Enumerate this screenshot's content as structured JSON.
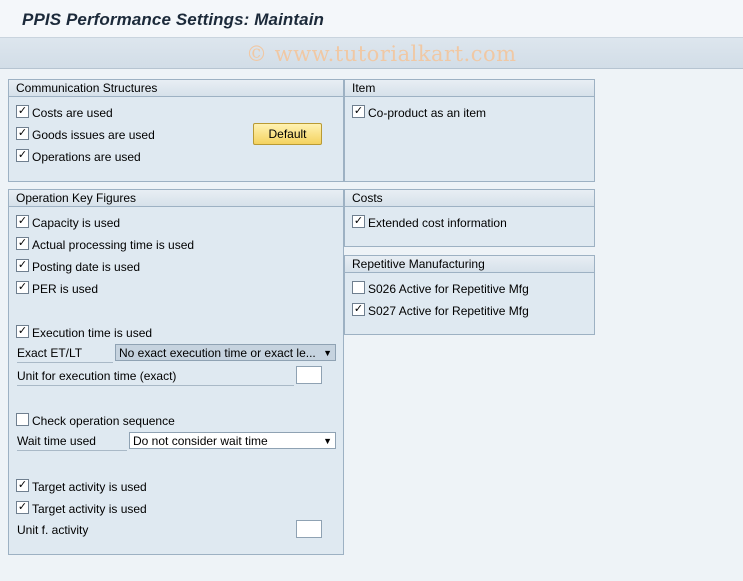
{
  "window": {
    "title": "PPIS Performance Settings: Maintain"
  },
  "watermark": "© www.tutorialkart.com",
  "communication_structures": {
    "heading": "Communication Structures",
    "items": [
      {
        "label": "Costs are used",
        "checked": true
      },
      {
        "label": "Goods issues are used",
        "checked": true
      },
      {
        "label": "Operations are used",
        "checked": true
      }
    ],
    "default_button": "Default"
  },
  "item": {
    "heading": "Item",
    "items": [
      {
        "label": "Co-product as an item",
        "checked": true
      }
    ]
  },
  "operation_key_figures": {
    "heading": "Operation Key Figures",
    "items": [
      {
        "label": "Capacity is used",
        "checked": true
      },
      {
        "label": "Actual processing time is used",
        "checked": true
      },
      {
        "label": "Posting date is used",
        "checked": true
      },
      {
        "label": "PER is used",
        "checked": true
      }
    ],
    "execution_time": {
      "label": "Execution time is used",
      "checked": true
    },
    "exact_et_lt": {
      "label": "Exact ET/LT",
      "value": "No exact execution time or exact le..."
    },
    "unit_exec_time": {
      "label": "Unit for execution time (exact)",
      "value": ""
    },
    "check_sequence": {
      "label": "Check operation sequence",
      "checked": false
    },
    "wait_time": {
      "label": "Wait time used",
      "value": "Do not consider wait time"
    },
    "target_activity_1": {
      "label": "Target activity is used",
      "checked": true
    },
    "target_activity_2": {
      "label": "Target activity is used",
      "checked": true
    },
    "unit_activity": {
      "label": "Unit f. activity",
      "value": ""
    }
  },
  "costs": {
    "heading": "Costs",
    "items": [
      {
        "label": "Extended cost information",
        "checked": true
      }
    ]
  },
  "repetitive_manufacturing": {
    "heading": "Repetitive Manufacturing",
    "items": [
      {
        "label": "S026 Active for Repetitive Mfg",
        "checked": false
      },
      {
        "label": "S027 Active for Repetitive Mfg",
        "checked": true
      }
    ]
  },
  "icons": {
    "check": "✓",
    "dropdown": "▼"
  }
}
